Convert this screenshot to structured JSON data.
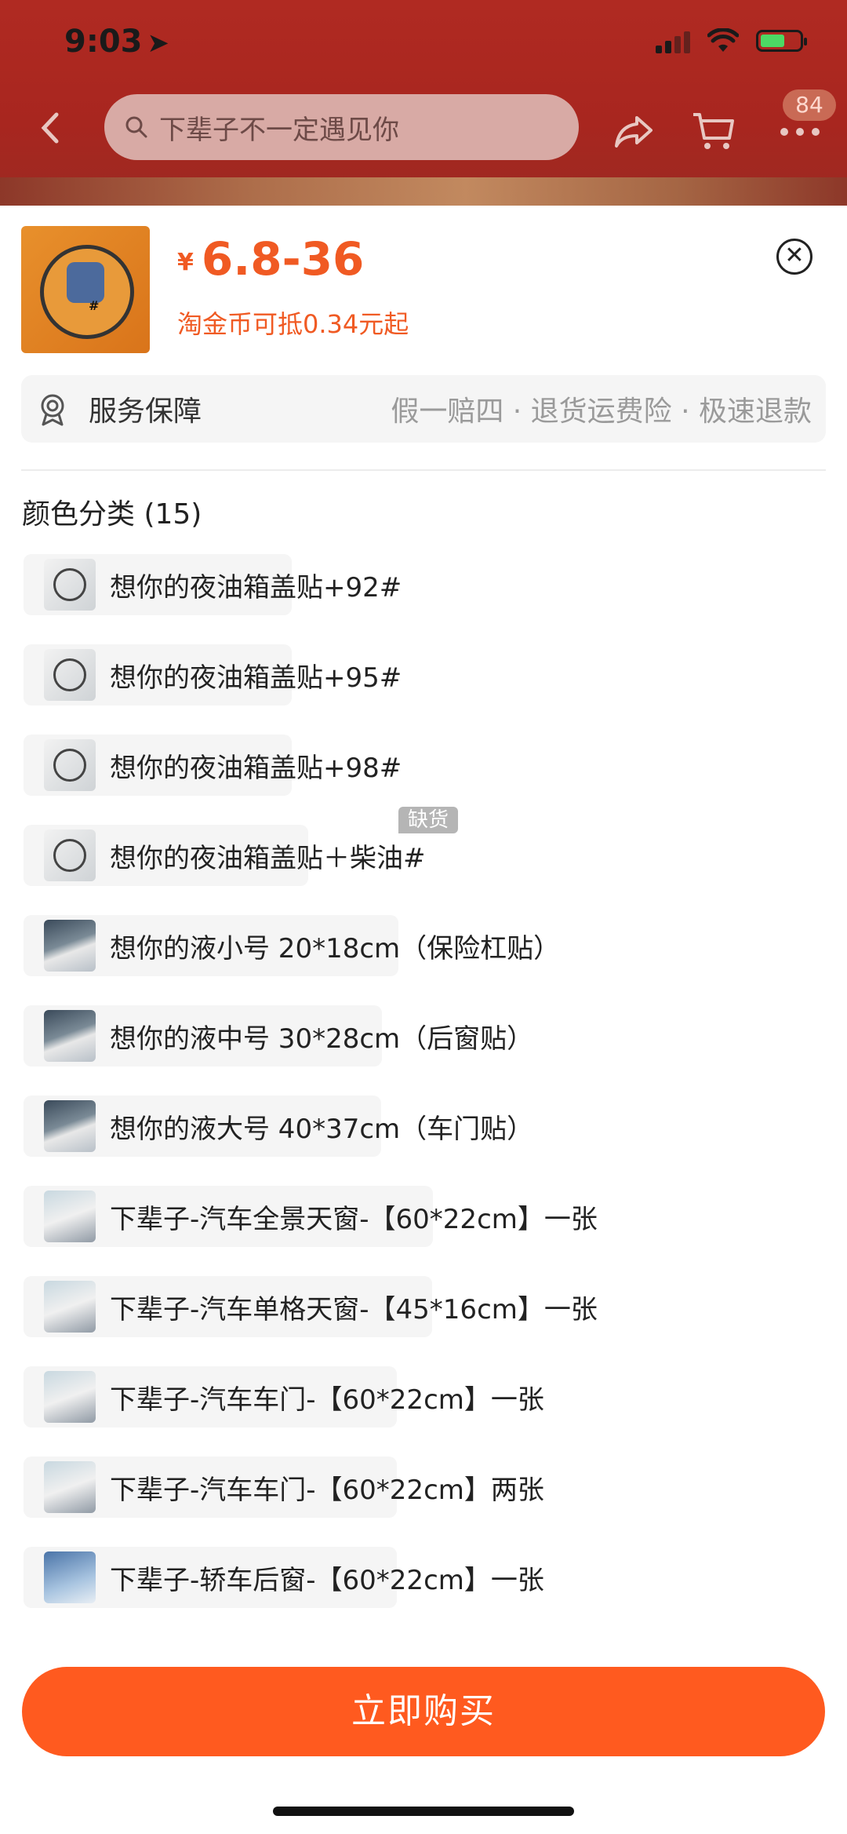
{
  "status_bar": {
    "time": "9:03",
    "location_icon": "navigation-arrow-icon",
    "signal_icon": "cellular-signal-icon",
    "wifi_icon": "wifi-icon",
    "battery_icon": "battery-charging-icon"
  },
  "header": {
    "back_icon": "chevron-left-icon",
    "search_placeholder": "下辈子不一定遇见你",
    "share_icon": "share-icon",
    "cart_icon": "cart-icon",
    "more_icon": "more-dots-icon",
    "more_badge": "84"
  },
  "product": {
    "currency": "¥",
    "price_range": "6.8-36",
    "coin_note": "淘金币可抵0.34元起",
    "accent_color": "#f05a23"
  },
  "service": {
    "label": "服务保障",
    "detail": "假一赔四 · 退货运费险 · 极速退款"
  },
  "options": {
    "title": "颜色分类 (15)",
    "out_of_stock_label": "缺货",
    "items": [
      {
        "label": "想你的夜油箱盖贴+92#"
      },
      {
        "label": "想你的夜油箱盖贴+95#"
      },
      {
        "label": "想你的夜油箱盖贴+98#"
      },
      {
        "label": "想你的夜油箱盖贴＋柴油#"
      },
      {
        "label": "想你的液小号 20*18cm（保险杠贴）"
      },
      {
        "label": "想你的液中号 30*28cm（后窗贴）"
      },
      {
        "label": "想你的液大号 40*37cm（车门贴）"
      },
      {
        "label": "下辈子-汽车全景天窗-【60*22cm】一张"
      },
      {
        "label": "下辈子-汽车单格天窗-【45*16cm】一张"
      },
      {
        "label": "下辈子-汽车车门-【60*22cm】一张"
      },
      {
        "label": "下辈子-汽车车门-【60*22cm】两张"
      },
      {
        "label": "下辈子-轿车后窗-【60*22cm】一张"
      }
    ]
  },
  "buy_button": {
    "label": "立即购买",
    "color": "#ff5a1f"
  }
}
